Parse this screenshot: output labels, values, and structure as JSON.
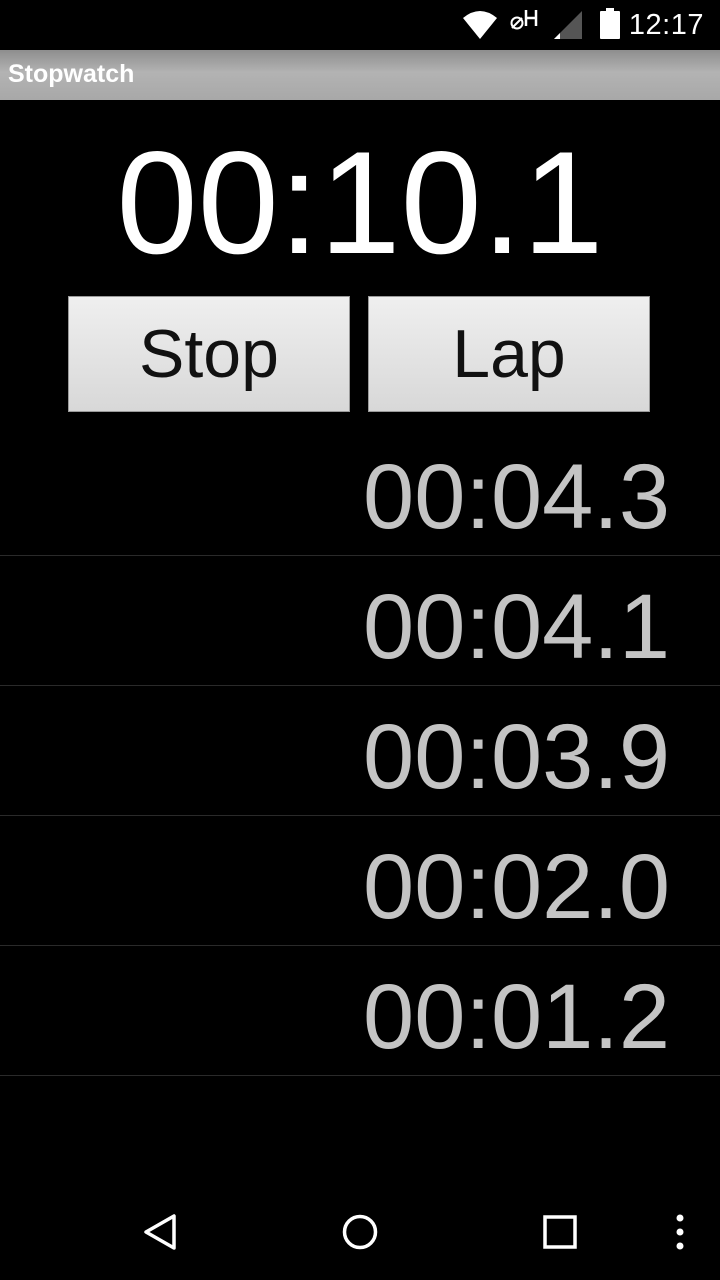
{
  "status_bar": {
    "time": "12:17",
    "icons": [
      "wifi-icon",
      "no-sim-h-icon",
      "signal-icon",
      "battery-icon"
    ]
  },
  "app": {
    "title": "Stopwatch"
  },
  "timer": {
    "display": "00:10.1"
  },
  "buttons": {
    "stop_label": "Stop",
    "lap_label": "Lap"
  },
  "laps": [
    {
      "time": "00:04.3"
    },
    {
      "time": "00:04.1"
    },
    {
      "time": "00:03.9"
    },
    {
      "time": "00:02.0"
    },
    {
      "time": "00:01.2"
    }
  ],
  "nav_bar": {
    "icons": [
      "back-icon",
      "home-icon",
      "recents-icon",
      "overflow-menu-icon"
    ]
  },
  "colors": {
    "background": "#000000",
    "lap_text": "#c4c4c4",
    "button_face": "#e4e4e4",
    "title_bar": "#a8a8a8"
  }
}
